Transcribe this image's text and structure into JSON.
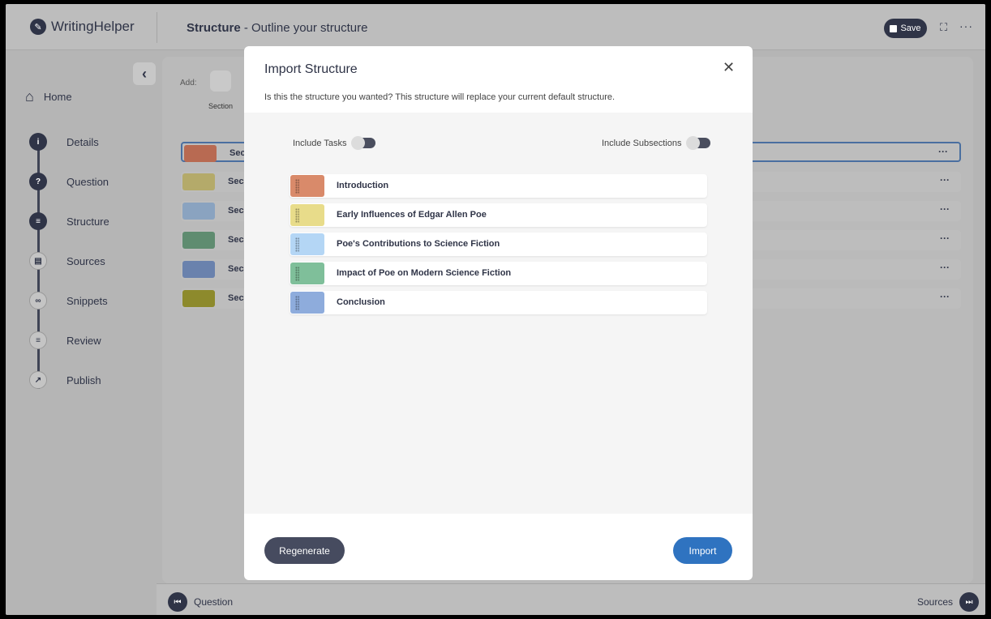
{
  "app": {
    "logo_text": "WritingHelper",
    "page_title_bold": "Structure",
    "page_title_rest": " - Outline your structure",
    "save_label": "Save"
  },
  "sidebar": {
    "home_label": "Home",
    "steps": [
      {
        "label": "Details",
        "icon": "info-icon",
        "glyph": "i"
      },
      {
        "label": "Question",
        "icon": "question-icon",
        "glyph": "?"
      },
      {
        "label": "Structure",
        "icon": "list-icon",
        "glyph": "≡"
      },
      {
        "label": "Sources",
        "icon": "book-icon",
        "glyph": "▤"
      },
      {
        "label": "Snippets",
        "icon": "link-icon",
        "glyph": "∞"
      },
      {
        "label": "Review",
        "icon": "checklist-icon",
        "glyph": "≡"
      },
      {
        "label": "Publish",
        "icon": "external-icon",
        "glyph": "↗"
      }
    ]
  },
  "main": {
    "add_label": "Add:",
    "add_section_label": "Section",
    "rows": [
      {
        "label": "Sec",
        "color": "#b86a52"
      },
      {
        "label": "Sec",
        "color": "#b4aa6a"
      },
      {
        "label": "Sec",
        "color": "#8aa3c0"
      },
      {
        "label": "Sec",
        "color": "#5f8c70"
      },
      {
        "label": "Sec",
        "color": "#6a82ad"
      },
      {
        "label": "Sec",
        "color": "#8d8a2c"
      }
    ],
    "row_menu": "···"
  },
  "footer": {
    "prev_label": "Question",
    "next_label": "Sources"
  },
  "modal": {
    "title": "Import Structure",
    "subtitle": "Is this the structure you wanted? This structure will replace your current default structure.",
    "include_tasks_label": "Include Tasks",
    "include_subsections_label": "Include Subsections",
    "items": [
      {
        "title": "Introduction",
        "color": "#d98a6a"
      },
      {
        "title": "Early Influences of Edgar Allen Poe",
        "color": "#e8dc8a"
      },
      {
        "title": "Poe's Contributions to Science Fiction",
        "color": "#b4d6f5"
      },
      {
        "title": "Impact of Poe on Modern Science Fiction",
        "color": "#7fbf9a"
      },
      {
        "title": "Conclusion",
        "color": "#8eacdc"
      }
    ],
    "regenerate_label": "Regenerate",
    "import_label": "Import"
  },
  "colors": {
    "accent": "#2f73c0",
    "dark": "#2f3447"
  }
}
